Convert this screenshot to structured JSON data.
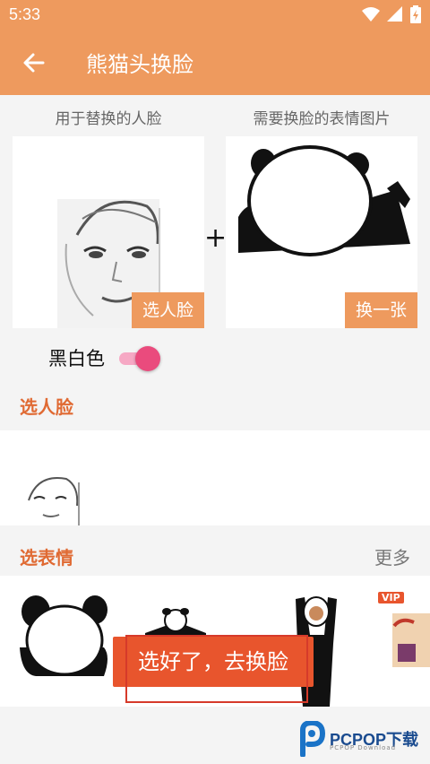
{
  "status": {
    "time": "5:33"
  },
  "appbar": {
    "title": "熊猫头换脸"
  },
  "captions": {
    "left": "用于替换的人脸",
    "right": "需要换脸的表情图片"
  },
  "cards": {
    "left_action": "选人脸",
    "right_action": "换一张"
  },
  "plus": "+",
  "bw_toggle": {
    "label": "黑白色",
    "enabled": true
  },
  "sections": {
    "faces": "选人脸",
    "stickers": "选表情",
    "more": "更多"
  },
  "sticker_texts": {
    "vip": "VIP"
  },
  "cta": "选好了，去换脸",
  "watermark": {
    "brand": "PCPOP下载",
    "sub": "PCPOP Download"
  },
  "colors": {
    "accent": "#ee9a5e",
    "cta": "#e8552d",
    "section": "#e06a33",
    "switch": "#ea4b7d"
  }
}
